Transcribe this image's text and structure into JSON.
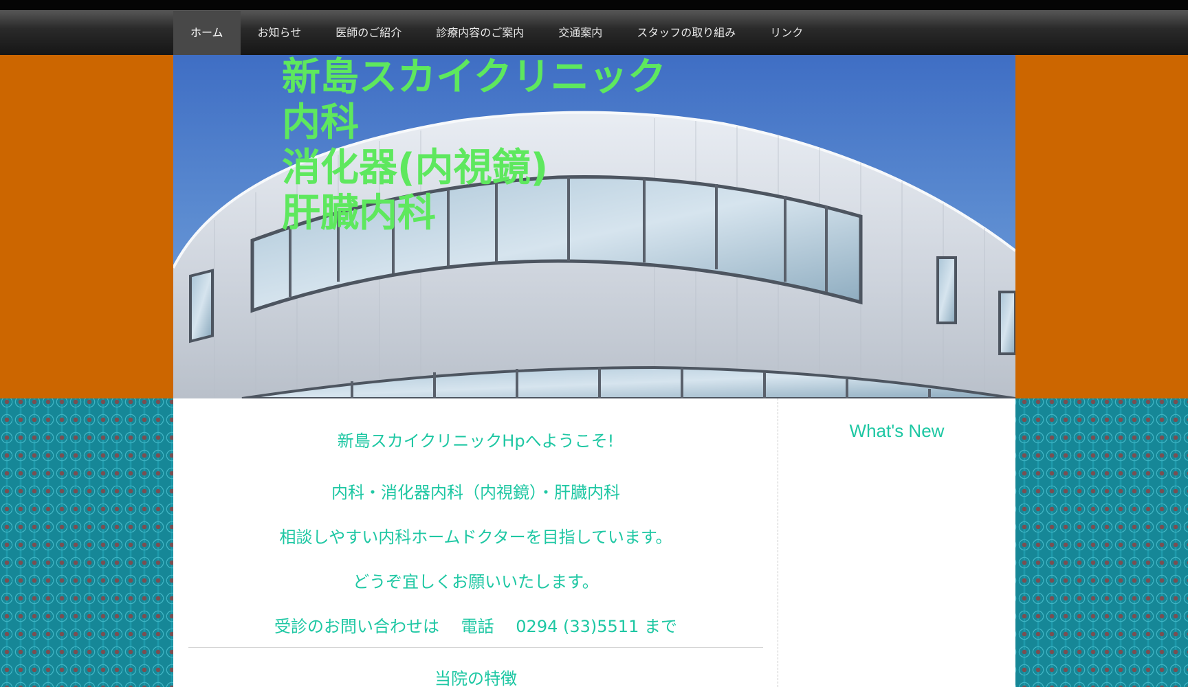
{
  "nav": {
    "items": [
      {
        "label": "ホーム",
        "active": true
      },
      {
        "label": "お知らせ"
      },
      {
        "label": "医師のご紹介"
      },
      {
        "label": "診療内容のご案内"
      },
      {
        "label": "交通案内"
      },
      {
        "label": "スタッフの取り組み"
      },
      {
        "label": "リンク"
      }
    ]
  },
  "header": {
    "title_lines": [
      "新島スカイクリニック",
      "内科",
      "消化器(内視鏡)",
      "肝臓内科"
    ]
  },
  "main": {
    "lines": [
      "新島スカイクリニックHpへようこそ!",
      "内科・消化器内科（内視鏡）・肝臓内科",
      "相談しやすい内科ホームドクターを目指しています。",
      "どうぞ宜しくお願いいたします。",
      "受診のお問い合わせは　 電話　 0294 (33)5511 まで"
    ],
    "section_heading": "当院の特徴"
  },
  "sidebar": {
    "title": "What's New"
  },
  "colors": {
    "text_accent": "#1ec7a3",
    "title_green": "#5ee85e",
    "orange_band": "#cc6600",
    "teal_pattern": "#1b8fa0"
  }
}
